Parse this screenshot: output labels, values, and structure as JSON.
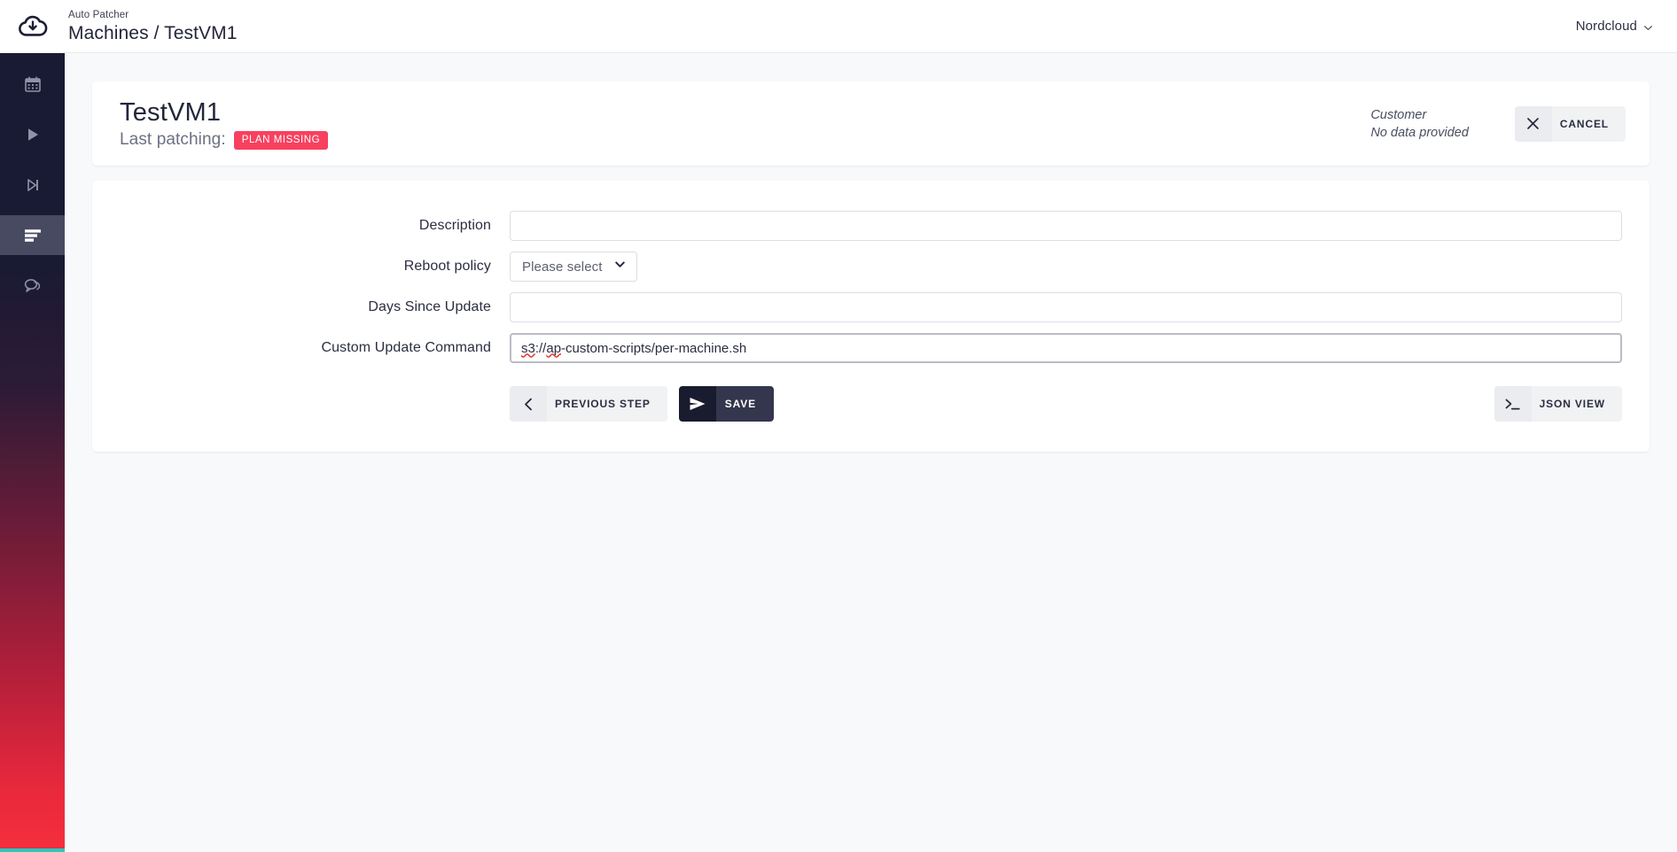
{
  "topbar": {
    "logo_icon": "cloud-logo-icon",
    "eyebrow": "Auto Patcher",
    "breadcrumb": "Machines / TestVM1",
    "user": {
      "label": "Nordcloud",
      "chevron_icon": "chevron-down-icon"
    }
  },
  "sidebar": {
    "items": [
      {
        "icon": "calendar-icon",
        "active": false
      },
      {
        "icon": "play-icon",
        "active": false
      },
      {
        "icon": "skip-forward-icon",
        "active": false
      },
      {
        "icon": "server-rack-icon",
        "active": true
      },
      {
        "icon": "chat-bubble-icon",
        "active": false
      }
    ],
    "accent_bottom": "#2ec7bc"
  },
  "header_card": {
    "machine_name": "TestVM1",
    "last_patching_label": "Last patching:",
    "status_badge": "PLAN MISSING",
    "status_badge_color": "#f8405f",
    "customer_label": "Customer",
    "customer_value": "No data provided",
    "cancel_button": {
      "label": "CANCEL",
      "icon": "close-x-icon"
    }
  },
  "form": {
    "fields": [
      {
        "label": "Description",
        "type": "text",
        "value": "",
        "placeholder": ""
      },
      {
        "label": "Reboot policy",
        "type": "select",
        "value": "Please select",
        "chevron_icon": "chevron-down-icon"
      },
      {
        "label": "Days Since Update",
        "type": "text",
        "value": "",
        "placeholder": ""
      },
      {
        "label": "Custom Update Command",
        "type": "text",
        "value": "s3://ap-custom-scripts/per-machine.sh",
        "placeholder": "",
        "focused": true,
        "spellcheck_words": [
          "s3",
          "ap"
        ]
      }
    ],
    "buttons": {
      "previous_step": {
        "label": "PREVIOUS STEP",
        "icon": "chevron-left-icon"
      },
      "save": {
        "label": "SAVE",
        "icon": "send-plane-icon"
      },
      "json_view": {
        "label": "JSON VIEW",
        "icon": "terminal-prompt-icon"
      }
    }
  }
}
